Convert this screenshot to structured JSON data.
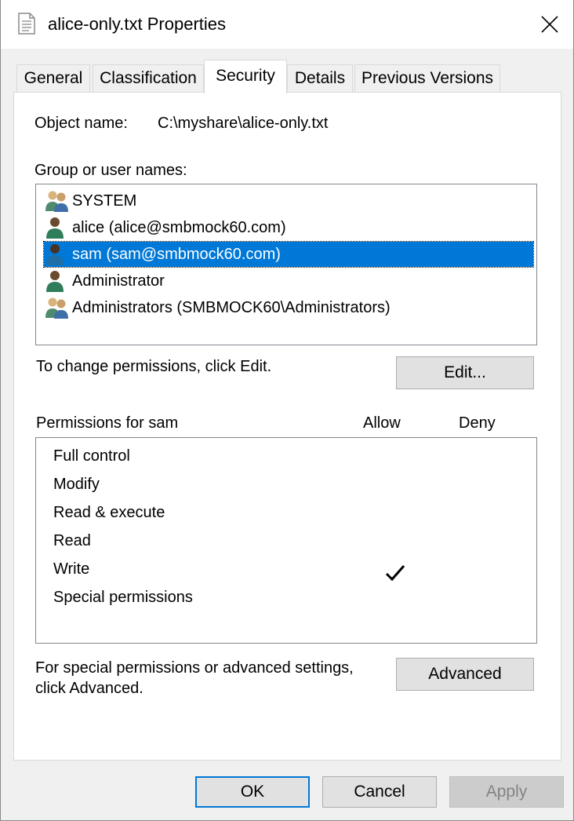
{
  "window": {
    "title": "alice-only.txt Properties"
  },
  "tabs": [
    {
      "label": "General"
    },
    {
      "label": "Classification"
    },
    {
      "label": "Security"
    },
    {
      "label": "Details"
    },
    {
      "label": "Previous Versions"
    }
  ],
  "security": {
    "object_name_label": "Object name:",
    "object_name_value": "C:\\myshare\\alice-only.txt",
    "group_label": "Group or user names:",
    "users": [
      {
        "name": "SYSTEM",
        "icon": "group-users-icon"
      },
      {
        "name": "alice (alice@smbmock60.com)",
        "icon": "user-icon"
      },
      {
        "name": "sam (sam@smbmock60.com)",
        "icon": "user-icon",
        "selected": true
      },
      {
        "name": "Administrator",
        "icon": "user-icon"
      },
      {
        "name": "Administrators (SMBMOCK60\\Administrators)",
        "icon": "group-users-icon"
      }
    ],
    "change_hint": "To change permissions, click Edit.",
    "edit_button": "Edit...",
    "permissions_label": "Permissions for sam",
    "allow_header": "Allow",
    "deny_header": "Deny",
    "permissions": [
      {
        "name": "Full control",
        "allow": false,
        "deny": false
      },
      {
        "name": "Modify",
        "allow": false,
        "deny": false
      },
      {
        "name": "Read & execute",
        "allow": false,
        "deny": false
      },
      {
        "name": "Read",
        "allow": false,
        "deny": false
      },
      {
        "name": "Write",
        "allow": true,
        "deny": false
      },
      {
        "name": "Special permissions",
        "allow": false,
        "deny": false
      }
    ],
    "advanced_hint_line1": "For special permissions or advanced settings,",
    "advanced_hint_line2": "click Advanced.",
    "advanced_button": "Advanced"
  },
  "footer": {
    "ok": "OK",
    "cancel": "Cancel",
    "apply": "Apply"
  },
  "colors": {
    "selection": "#0078d7",
    "accent_border": "#0078d7"
  }
}
